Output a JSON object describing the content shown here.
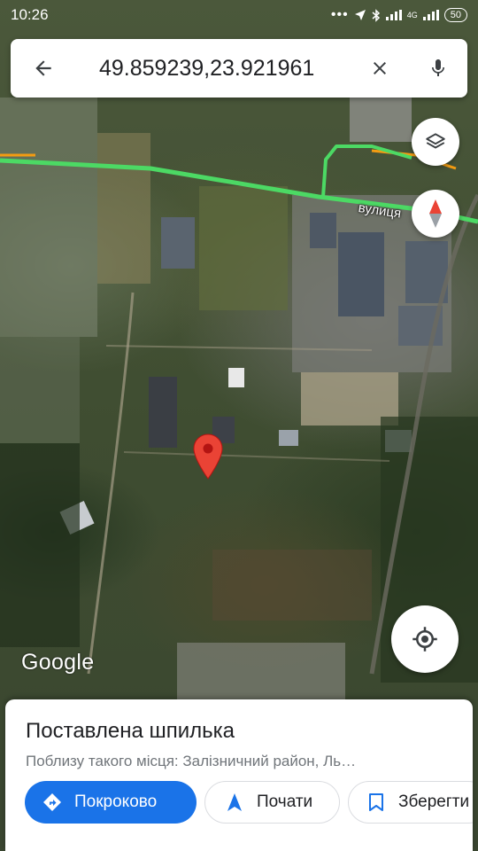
{
  "status_bar": {
    "time": "10:26",
    "network": "4G",
    "battery": "50"
  },
  "search": {
    "query": "49.859239,23.921961"
  },
  "map": {
    "street_label": "вулиця",
    "attribution": "Google",
    "pin_color": "#ea4335",
    "route_color": "#4cd964"
  },
  "place_sheet": {
    "title": "Поставлена шпилька",
    "subtitle": "Поблизу такого місця: Залізничний район, Ль…",
    "actions": {
      "directions": "Покроково",
      "start": "Почати",
      "save": "Зберегти"
    }
  },
  "colors": {
    "accent": "#1a73e8",
    "text_primary": "#202124",
    "text_secondary": "#70757a"
  }
}
